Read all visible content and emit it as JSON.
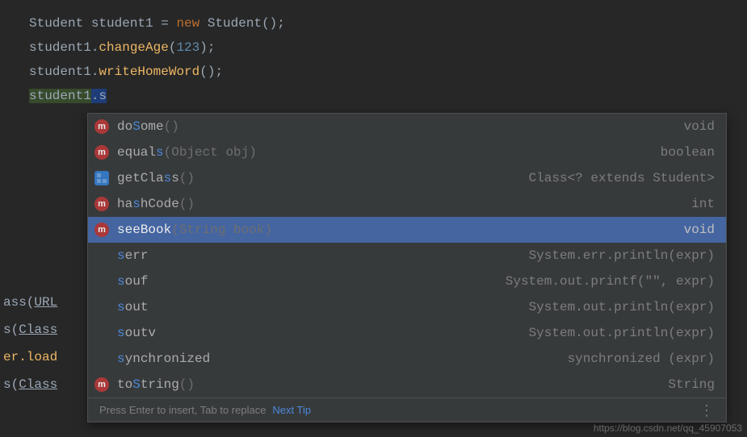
{
  "code": {
    "line1_pre": "Student student1 = ",
    "line1_kw": "new",
    "line1_post": " Student();",
    "line2_obj": "student1",
    "line2_dot": ".",
    "line2_method": "changeAge",
    "line2_args": "(",
    "line2_num": "123",
    "line2_close": ");",
    "line3_obj": "student1",
    "line3_dot": ".",
    "line3_method": "writeHomeWord",
    "line3_close": "();",
    "line4_obj": "student1",
    "line4_dotS": ".s"
  },
  "suggestions": [
    {
      "icon": "method",
      "pre": "do",
      "match": "S",
      "post": "ome",
      "params": "()",
      "ret": "void"
    },
    {
      "icon": "method",
      "pre": "equal",
      "match": "s",
      "post": "",
      "params": "(Object obj)",
      "ret": "boolean"
    },
    {
      "icon": "class",
      "pre": "getCla",
      "match": "s",
      "post": "s",
      "params": "()",
      "ret": "Class<? extends Student>"
    },
    {
      "icon": "method",
      "pre": "ha",
      "match": "s",
      "post": "hCode",
      "params": "()",
      "ret": "int"
    },
    {
      "icon": "method",
      "pre": "",
      "match": "s",
      "post": "eeBook",
      "params": "(String book)",
      "ret": "void",
      "selected": true
    },
    {
      "icon": "none",
      "pre": "",
      "match": "s",
      "post": "err",
      "params": "",
      "ret": "System.err.println(expr)"
    },
    {
      "icon": "none",
      "pre": "",
      "match": "s",
      "post": "ouf",
      "params": "",
      "ret": "System.out.printf(\"\", expr)"
    },
    {
      "icon": "none",
      "pre": "",
      "match": "s",
      "post": "out",
      "params": "",
      "ret": "System.out.println(expr)"
    },
    {
      "icon": "none",
      "pre": "",
      "match": "s",
      "post": "outv",
      "params": "",
      "ret": "System.out.println(expr)"
    },
    {
      "icon": "none",
      "pre": "",
      "match": "s",
      "post": "ynchronized",
      "params": "",
      "ret": "synchronized (expr)"
    },
    {
      "icon": "method",
      "pre": "to",
      "match": "S",
      "post": "tring",
      "params": "()",
      "ret": "String"
    }
  ],
  "footer": {
    "hint": "Press Enter to insert, Tab to replace",
    "next_tip": "Next Tip"
  },
  "bg_code": [
    {
      "prefix": "ass(",
      "text": "URL"
    },
    {
      "prefix": "s(",
      "text": "Class"
    },
    {
      "prefix": "er.load",
      "text": ""
    },
    {
      "prefix": "s(",
      "text": "Class"
    }
  ],
  "watermark": "https://blog.csdn.net/qq_45907053"
}
